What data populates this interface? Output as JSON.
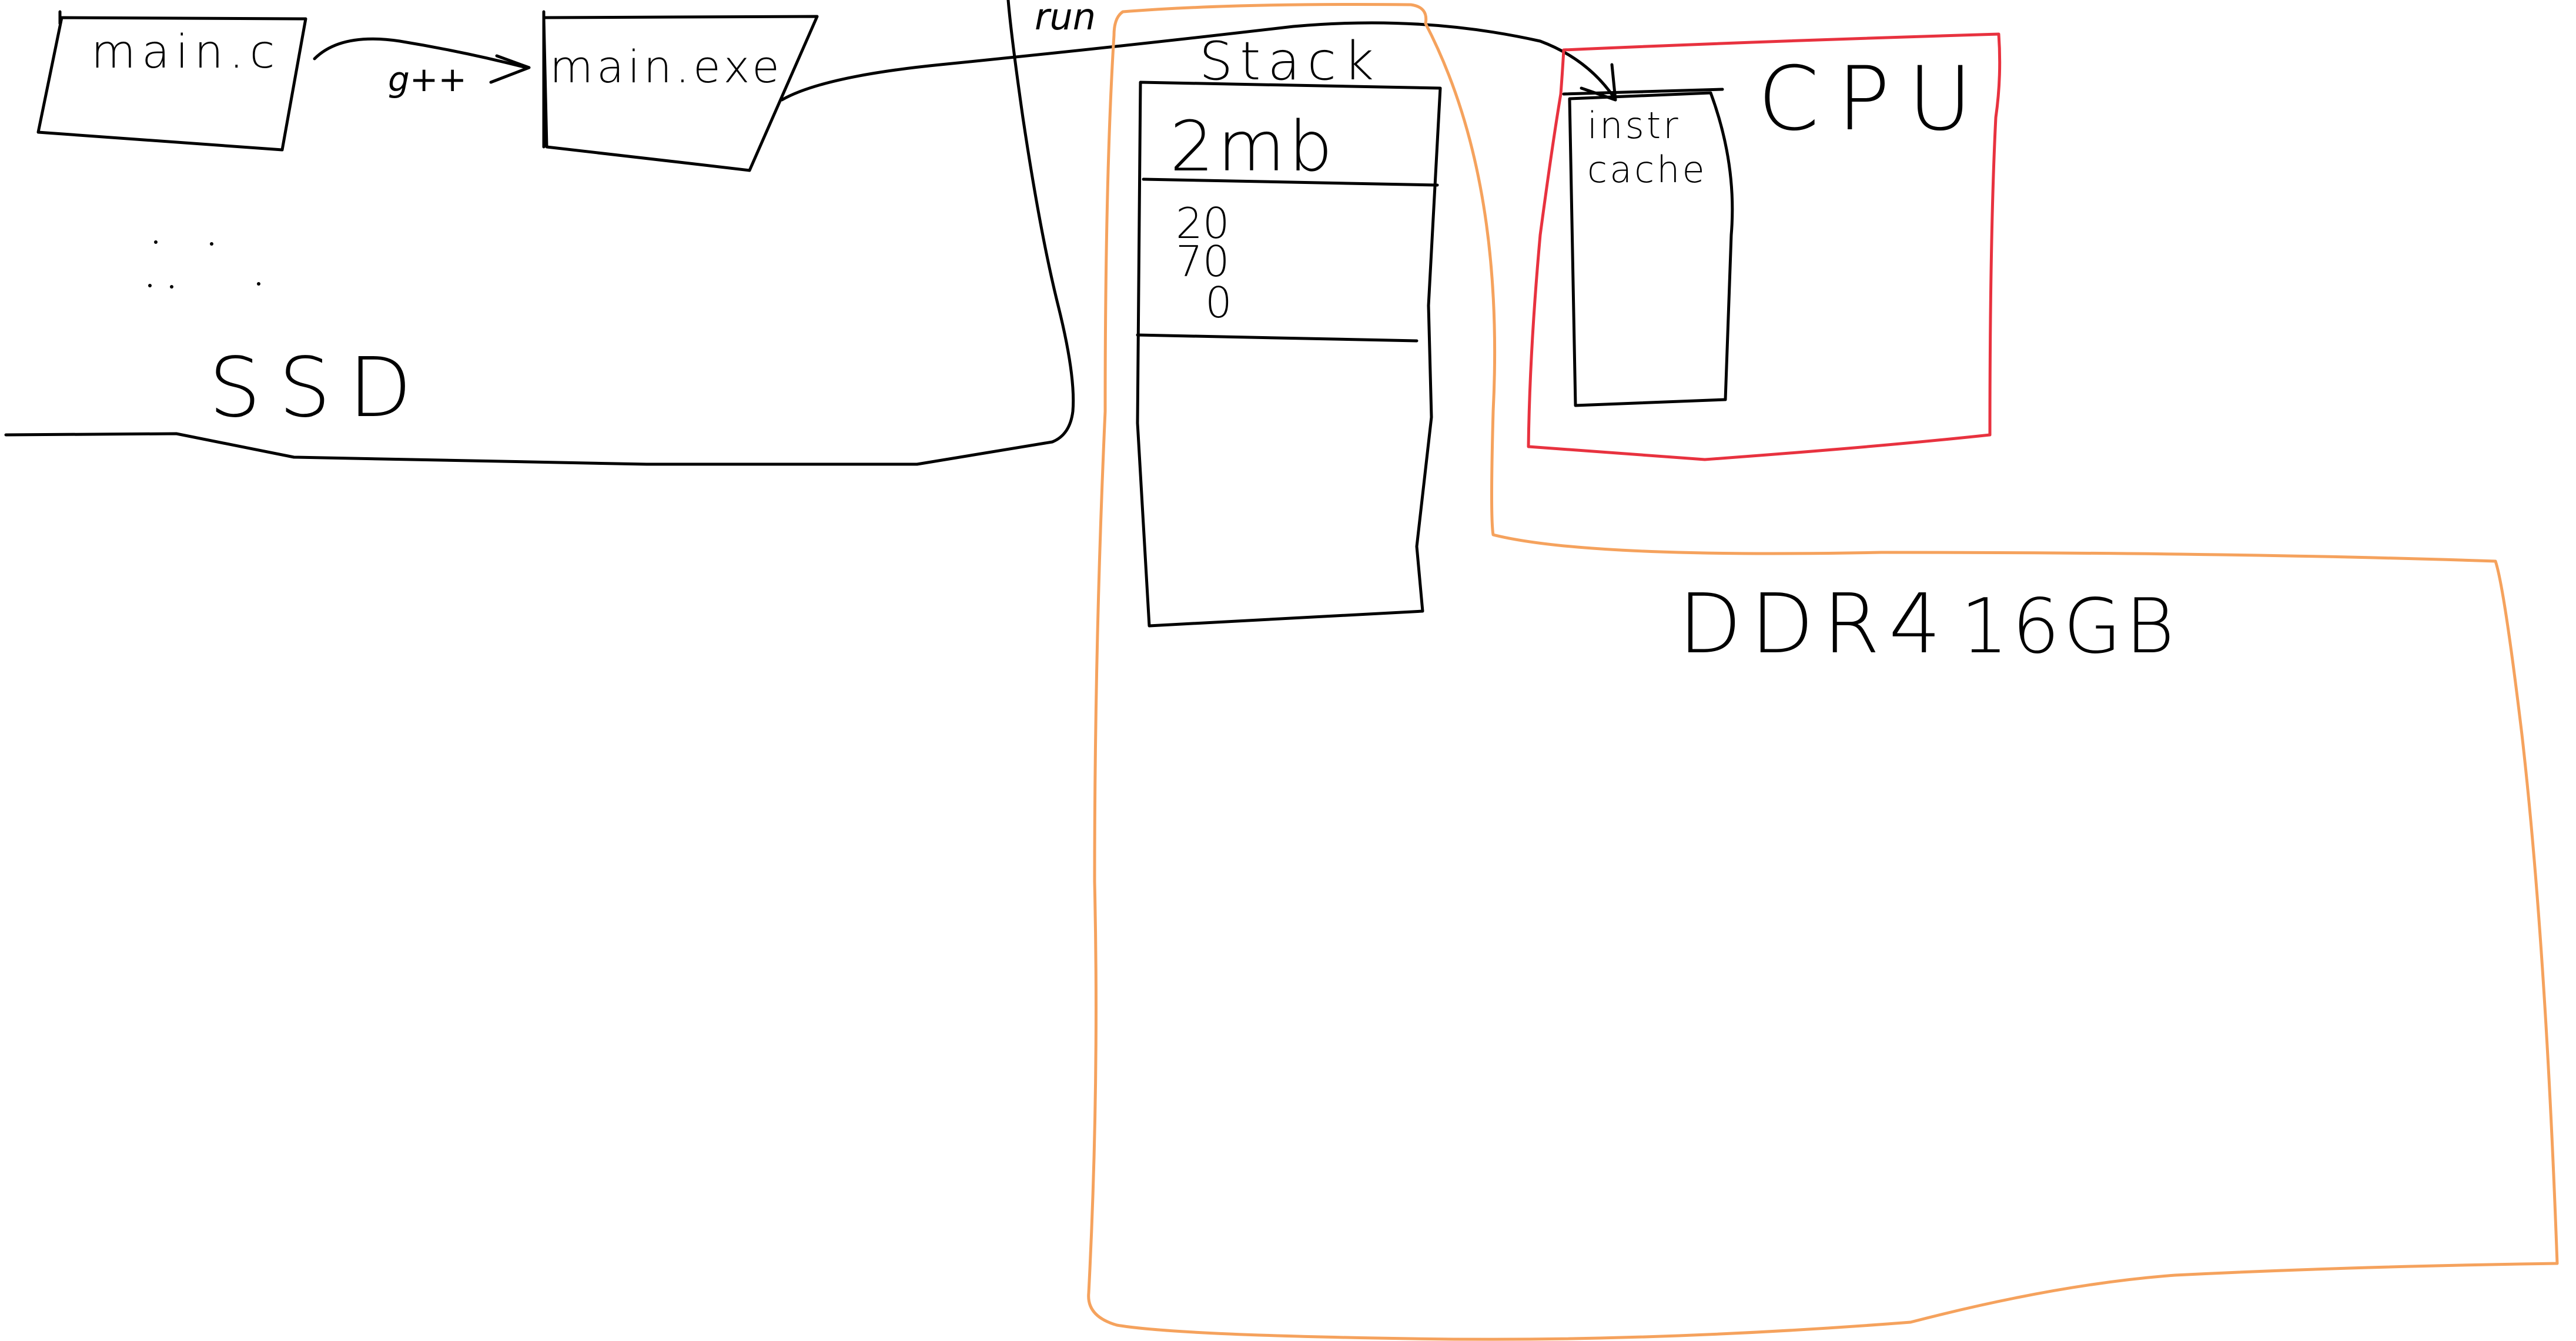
{
  "labels": {
    "main_c": "main.c",
    "gcc": "g++",
    "main_exe": "main.exe",
    "run": "run",
    "ssd": "SSD",
    "stack": "Stack",
    "stack_size": "2mb",
    "stack_value_1": "20",
    "stack_value_2": "70",
    "stack_value_3": "0",
    "instr_cache_line1": "instr",
    "instr_cache_line2": "cache",
    "cpu": "CPU",
    "ram": "DDR4",
    "ram_size": "16GB"
  },
  "colors": {
    "ink": "#000000",
    "ram_outline": "#f5a25d",
    "cpu_outline": "#e8323f",
    "background": "#ffffff"
  }
}
